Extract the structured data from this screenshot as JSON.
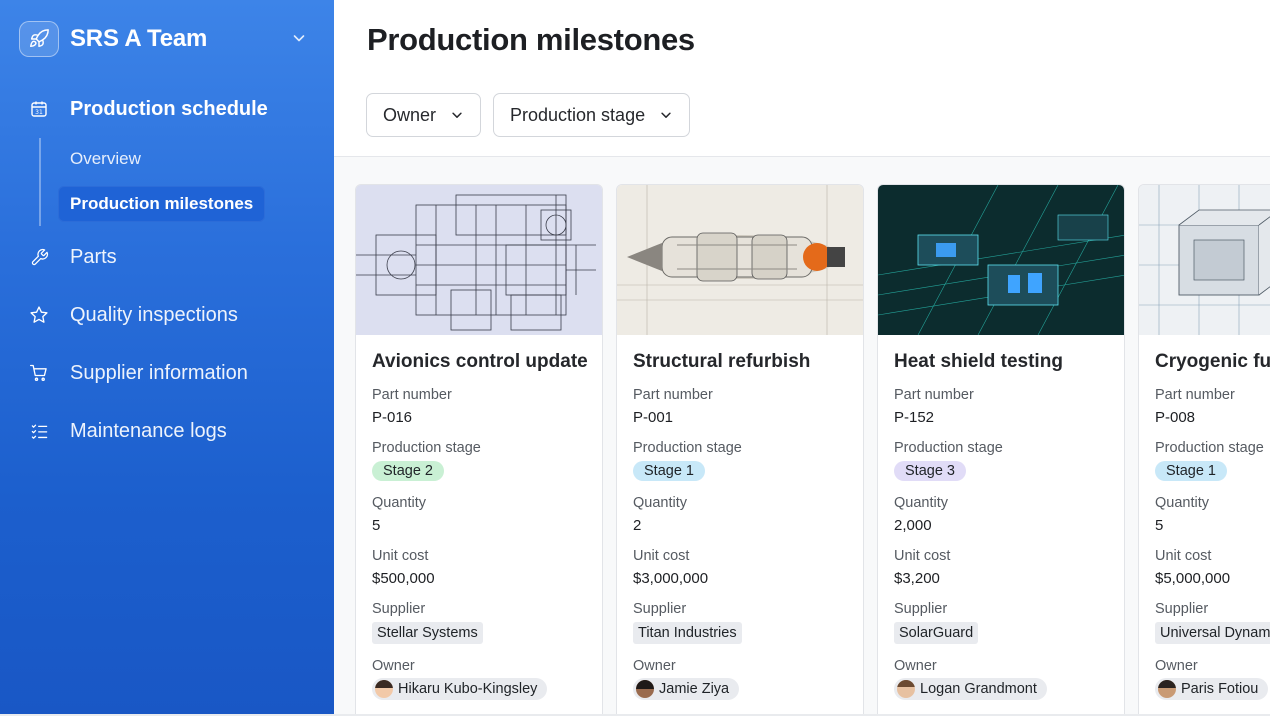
{
  "sidebar": {
    "team_name": "SRS A Team",
    "team_icon": "rocket-icon",
    "items": [
      {
        "label": "Production schedule",
        "icon": "calendar-icon",
        "active": true
      },
      {
        "label": "Parts",
        "icon": "wrench-icon"
      },
      {
        "label": "Quality inspections",
        "icon": "star-icon"
      },
      {
        "label": "Supplier information",
        "icon": "cart-icon"
      },
      {
        "label": "Maintenance logs",
        "icon": "checklist-icon"
      }
    ],
    "subitems": [
      {
        "label": "Overview"
      },
      {
        "label": "Production milestones",
        "active": true
      }
    ]
  },
  "main": {
    "title": "Production milestones",
    "filters": [
      {
        "label": "Owner"
      },
      {
        "label": "Production stage"
      }
    ],
    "field_labels": {
      "part_number": "Part number",
      "stage": "Production stage",
      "quantity": "Quantity",
      "unit_cost": "Unit cost",
      "supplier": "Supplier",
      "owner": "Owner"
    },
    "cards": [
      {
        "title": "Avionics control update",
        "part_number": "P-016",
        "stage": "Stage 2",
        "stage_color": "#c9f0d4",
        "quantity": "5",
        "unit_cost": "$500,000",
        "supplier": "Stellar Systems",
        "owner": "Hikaru Kubo-Kingsley"
      },
      {
        "title": "Structural refurbish",
        "part_number": "P-001",
        "stage": "Stage 1",
        "stage_color": "#c8e8f8",
        "quantity": "2",
        "unit_cost": "$3,000,000",
        "supplier": "Titan Industries",
        "owner": "Jamie Ziya"
      },
      {
        "title": "Heat shield testing",
        "part_number": "P-152",
        "stage": "Stage 3",
        "stage_color": "#e1dcf7",
        "quantity": "2,000",
        "unit_cost": "$3,200",
        "supplier": "SolarGuard",
        "owner": "Logan Grandmont"
      },
      {
        "title": "Cryogenic fu",
        "part_number": "P-008",
        "stage": "Stage 1",
        "stage_color": "#c8e8f8",
        "quantity": "5",
        "unit_cost": "$5,000,000",
        "supplier": "Universal Dynam",
        "owner": "Paris Fotiou"
      }
    ]
  }
}
